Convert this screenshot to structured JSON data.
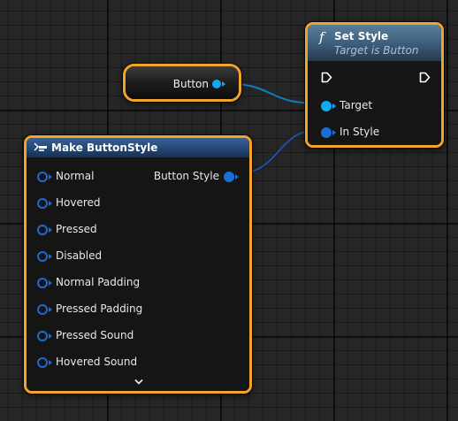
{
  "variable_node": {
    "label": "Button"
  },
  "set_style_node": {
    "title": "Set Style",
    "subtitle": "Target is Button",
    "function_icon": "f",
    "inputs": [
      "Target",
      "In Style"
    ]
  },
  "make_style_node": {
    "title": "Make ButtonStyle",
    "inputs": [
      "Normal",
      "Hovered",
      "Pressed",
      "Disabled",
      "Normal Padding",
      "Pressed Padding",
      "Pressed Sound",
      "Hovered Sound"
    ],
    "output": "Button Style"
  },
  "colors": {
    "selection_outline": "#f0a52a",
    "object_pin": "#11a9f0",
    "struct_pin": "#1e6ad2",
    "function_header": "#3b5c79",
    "struct_header": "#234775"
  },
  "icons": {
    "function": "function-icon",
    "make_struct": "make-struct-icon",
    "exec": "exec-pin-icon",
    "expand": "chevron-down-icon"
  }
}
